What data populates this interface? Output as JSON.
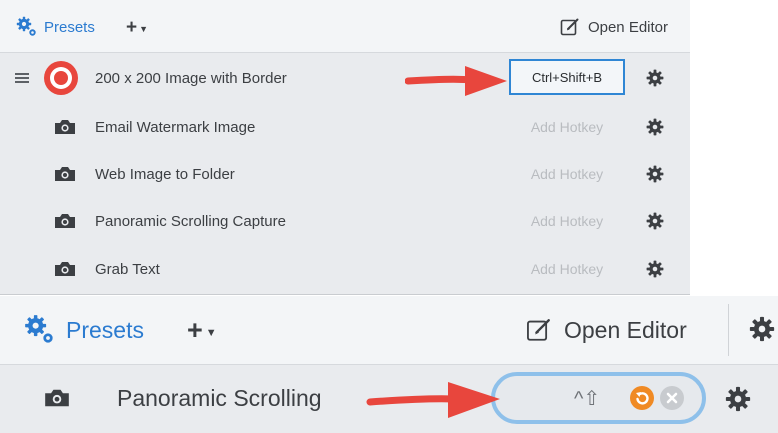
{
  "panel_top": {
    "header": {
      "presets_label": "Presets",
      "add_label": "+",
      "open_editor_label": "Open Editor"
    },
    "rows": [
      {
        "label": "200 x 200 Image with Border",
        "hotkey": "Ctrl+Shift+B",
        "icon": "capture-record-icon",
        "active": true
      },
      {
        "label": "Email Watermark Image",
        "hotkey": "Add Hotkey",
        "icon": "camera-icon"
      },
      {
        "label": "Web Image to Folder",
        "hotkey": "Add Hotkey",
        "icon": "camera-icon"
      },
      {
        "label": "Panoramic Scrolling Capture",
        "hotkey": "Add Hotkey",
        "icon": "camera-icon"
      },
      {
        "label": "Grab Text",
        "hotkey": "Add Hotkey",
        "icon": "camera-icon"
      }
    ]
  },
  "panel_bottom": {
    "header": {
      "presets_label": "Presets",
      "add_label": "+",
      "open_editor_label": "Open Editor"
    },
    "row": {
      "label": "Panoramic Scrolling",
      "hotkey_keys": "^⇧"
    }
  },
  "colors": {
    "accent_blue": "#2b7bd0",
    "annotation_red": "#e8463d",
    "hotkey_ring": "#8ec0ea",
    "capture_orange": "#f08a24"
  }
}
